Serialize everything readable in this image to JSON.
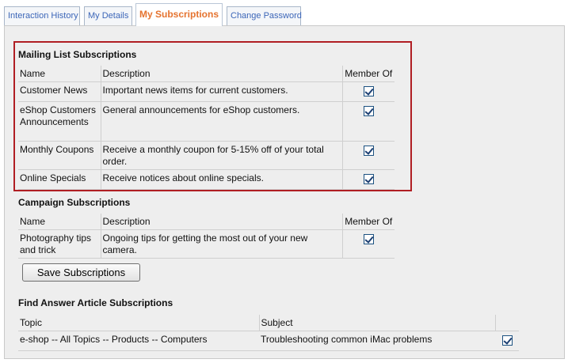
{
  "tabs": [
    {
      "label": "Interaction History"
    },
    {
      "label": "My Details"
    },
    {
      "label": "My Subscriptions"
    },
    {
      "label": "Change Password"
    }
  ],
  "mailing": {
    "title": "Mailing List Subscriptions",
    "headers": {
      "name": "Name",
      "description": "Description",
      "member": "Member Of"
    },
    "rows": [
      {
        "name": "Customer News",
        "description": "Important news items for current customers.",
        "member": true
      },
      {
        "name": "eShop Customers Announcements",
        "description": "General announcements for eShop customers.",
        "member": true
      },
      {
        "name": "Monthly Coupons",
        "description": "Receive a monthly coupon for 5-15% off of your total order.",
        "member": true
      },
      {
        "name": "Online Specials",
        "description": "Receive notices about online specials.",
        "member": true
      }
    ]
  },
  "campaign": {
    "title": "Campaign Subscriptions",
    "headers": {
      "name": "Name",
      "description": "Description",
      "member": "Member Of"
    },
    "rows": [
      {
        "name": "Photography tips and trick",
        "description": "Ongoing tips for getting the most out of your new camera.",
        "member": true
      }
    ]
  },
  "save_button": {
    "label": "Save Subscriptions"
  },
  "answers": {
    "title": "Find Answer Article Subscriptions",
    "headers": {
      "topic": "Topic",
      "subject": "Subject"
    },
    "rows": [
      {
        "topic": "e-shop -- All Topics -- Products -- Computers",
        "subject": "Troubleshooting common iMac problems",
        "member": true
      }
    ]
  },
  "colors": {
    "active_tab": "#e5732f",
    "tab_text": "#3c66b8",
    "highlight_border": "#b01e23"
  }
}
